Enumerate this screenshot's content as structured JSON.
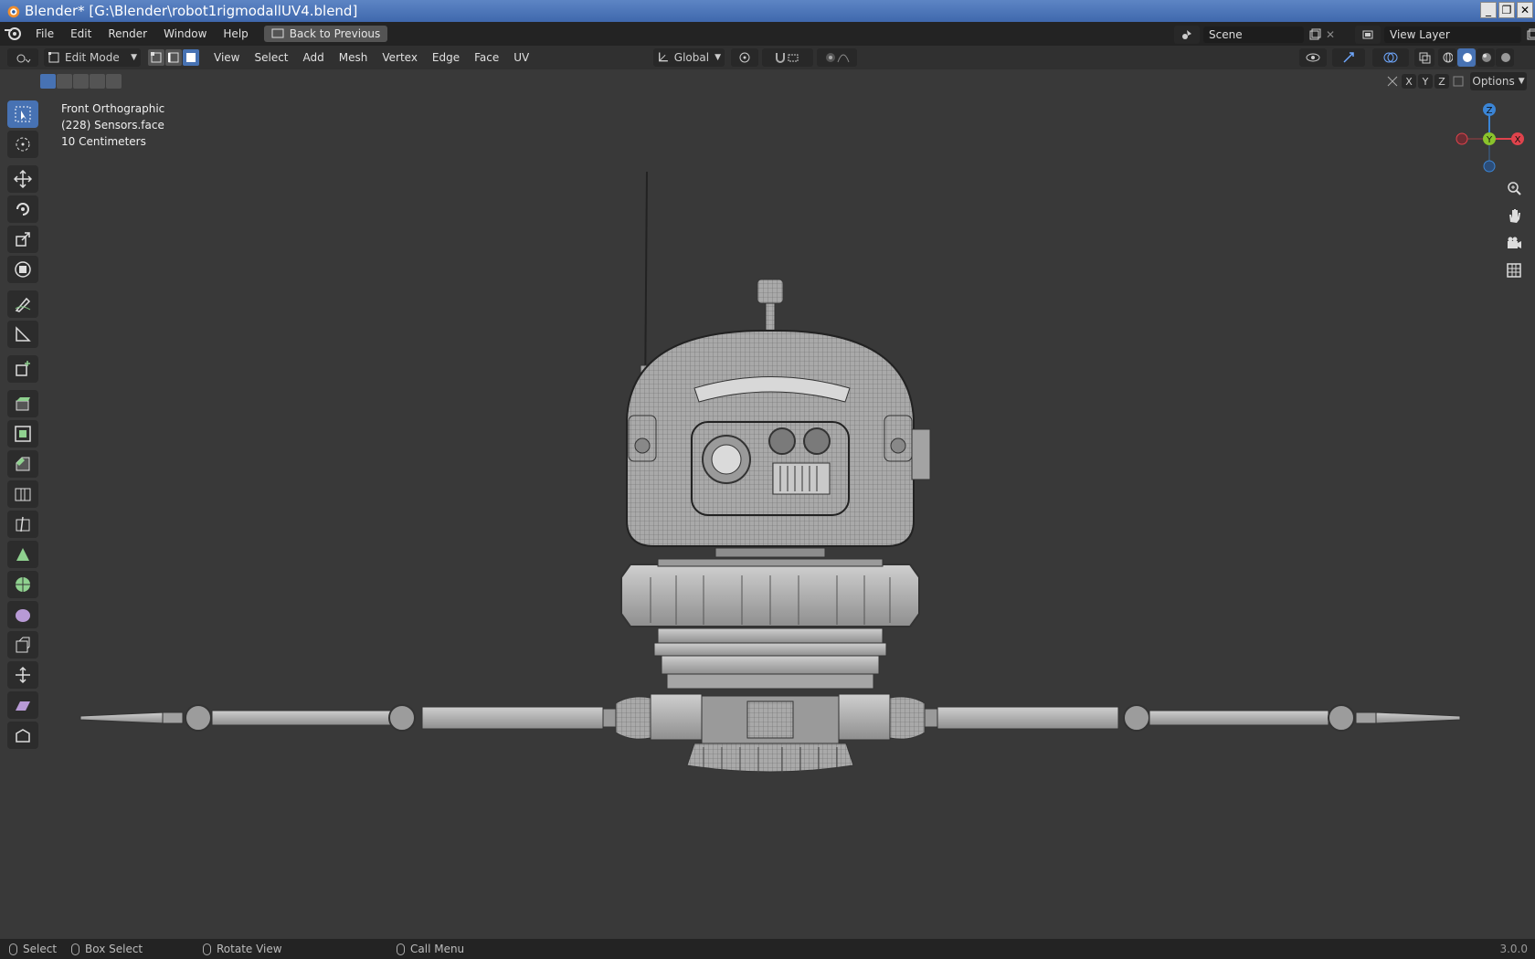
{
  "window": {
    "title": "Blender* [G:\\Blender\\robot1rigmodallUV4.blend]"
  },
  "menu": {
    "items": [
      "File",
      "Edit",
      "Render",
      "Window",
      "Help"
    ],
    "back_button": "Back to Previous"
  },
  "scene": {
    "name": "Scene"
  },
  "view_layer": {
    "name": "View Layer"
  },
  "header": {
    "mode": "Edit Mode",
    "menus": [
      "View",
      "Select",
      "Add",
      "Mesh",
      "Vertex",
      "Edge",
      "Face",
      "UV"
    ],
    "transform_orientation": "Global",
    "options_label": "Options",
    "axes": [
      "X",
      "Y",
      "Z"
    ]
  },
  "viewport": {
    "view_name": "Front Orthographic",
    "object_info": "(228) Sensors.face",
    "scale_info": "10 Centimeters"
  },
  "gizmo": {
    "z": "Z",
    "y": "Y",
    "x": "X"
  },
  "status": {
    "select": "Select",
    "box_select": "Box Select",
    "rotate_view": "Rotate View",
    "call_menu": "Call Menu",
    "version": "3.0.0"
  },
  "colors": {
    "selection_blue": "#4772b3",
    "title_blue": "#4a73b8",
    "x_axis": "#e0434c",
    "y_axis": "#8ac32c",
    "z_axis": "#3b85d6"
  },
  "icons": [
    "blender-logo",
    "cursor-icon",
    "move-icon",
    "rotate-icon",
    "scale-icon",
    "transform-icon",
    "annotate-icon",
    "measure-icon",
    "add-cube-icon",
    "extrude-icon",
    "inset-icon",
    "bevel-icon",
    "loopcut-icon",
    "knife-icon",
    "polybuild-icon",
    "spin-icon",
    "smooth-icon",
    "edge-slide-icon",
    "shrink-icon",
    "shear-icon",
    "rip-icon",
    "zoom-icon",
    "hand-icon",
    "camera-icon",
    "grid-icon"
  ]
}
